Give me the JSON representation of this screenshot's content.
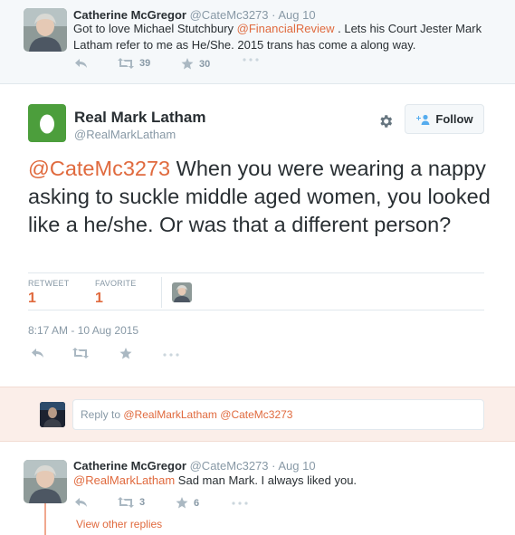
{
  "top_tweet": {
    "name": "Catherine McGregor",
    "handle": "@CateMc3273",
    "date": "· Aug 10",
    "text_line1_before": "Got to love Michael Stutchbury ",
    "text_line1_mention": "@FinancialReview",
    "text_line1_after": " . Lets his Court Jester Mark",
    "text_line2": "Latham refer to me as He/She. 2015 trans has come a along way.",
    "retweets": "39",
    "favorites": "30"
  },
  "main_tweet": {
    "name": "Real Mark Latham",
    "handle": "@RealMarkLatham",
    "follow_label": "Follow",
    "mention": "@CateMc3273",
    "text": " When you were wearing a nappy asking to suckle middle aged women, you looked like a he/she. Or was that a different person?",
    "retweet_label": "RETWEET",
    "retweet_count": "1",
    "favorite_label": "FAVORITE",
    "favorite_count": "1",
    "timestamp": "8:17 AM - 10 Aug 2015"
  },
  "reply_box": {
    "placeholder_prefix": "Reply to ",
    "mention1": "@RealMarkLatham",
    "mention2": " @CateMc3273"
  },
  "bottom_tweet": {
    "name": "Catherine McGregor",
    "handle": "@CateMc3273",
    "date": "· Aug 10",
    "mention": "@RealMarkLatham",
    "text": " Sad man Mark. I always liked you.",
    "retweets": "3",
    "favorites": "6",
    "view_replies": "View other replies"
  },
  "colors": {
    "accent": "#e06a3e",
    "muted": "#8899a6",
    "egg_green": "#4c9e3c",
    "reply_bg": "#fbeee9"
  },
  "icons": [
    "reply-icon",
    "retweet-icon",
    "star-icon",
    "more-icon",
    "gear-icon",
    "follow-person-icon",
    "egg-icon"
  ]
}
